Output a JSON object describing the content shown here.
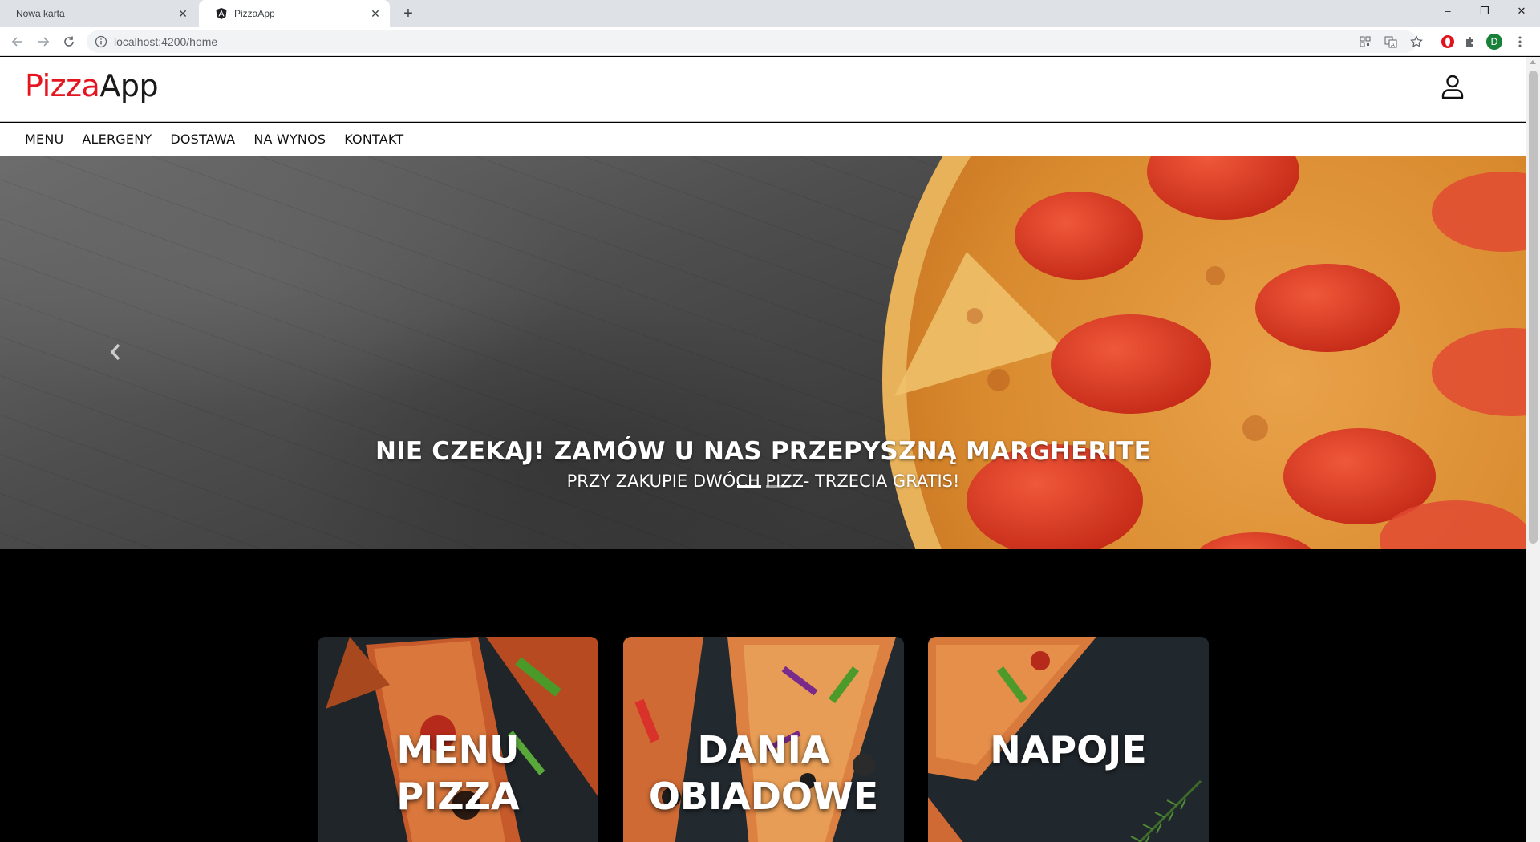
{
  "browser": {
    "tabs": [
      {
        "title": "Nowa karta",
        "active": false
      },
      {
        "title": "PizzaApp",
        "active": true
      }
    ],
    "url": "localhost:4200/home",
    "profile_initial": "D"
  },
  "site": {
    "logo": {
      "part1": "Pizza",
      "part2": "App"
    },
    "nav": [
      "MENU",
      "ALERGENY",
      "DOSTAWA",
      "NA WYNOS",
      "KONTAKT"
    ],
    "colors": {
      "brand_red": "#e4151f",
      "text": "#111111"
    }
  },
  "hero": {
    "title": "NIE CZEKAJ! ZAMÓW U NAS PRZEPYSZNĄ MARGHERITE",
    "subtitle": "PRZY ZAKUPIE DWÓCH PIZZ- TRZECIA GRATIS!",
    "slides_count": 2,
    "active_slide": 1
  },
  "cards": [
    {
      "line1": "MENU",
      "line2": "PIZZA"
    },
    {
      "line1": "DANIA",
      "line2": "OBIADOWE"
    },
    {
      "line1": "NAPOJE",
      "line2": ""
    }
  ]
}
